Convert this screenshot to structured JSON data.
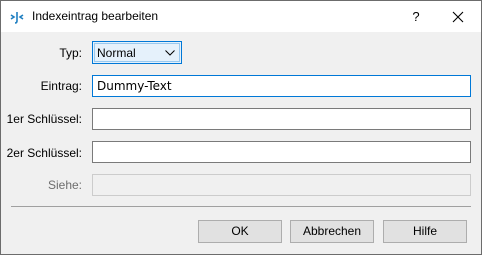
{
  "window": {
    "title": "Indexeintrag bearbeiten",
    "help_glyph": "?",
    "icons": {
      "app": "indesign-app-icon",
      "close": "close-icon",
      "dropdown": "chevron-down-icon"
    }
  },
  "form": {
    "type_label": "Typ:",
    "type_value": "Normal",
    "entry_label": "Eintrag:",
    "entry_value": "Dummy-Text",
    "key1_label": "1er Schlüssel:",
    "key1_value": "",
    "key2_label": "2er Schlüssel:",
    "key2_value": "",
    "see_label": "Siehe:",
    "see_value": ""
  },
  "buttons": {
    "ok": "OK",
    "cancel": "Abbrechen",
    "help": "Hilfe"
  },
  "colors": {
    "dialog_bg": "#f0f0f0",
    "focus_border": "#0078d7",
    "button_bg": "#e1e1e1",
    "app_icon": "#1f7fc1"
  }
}
